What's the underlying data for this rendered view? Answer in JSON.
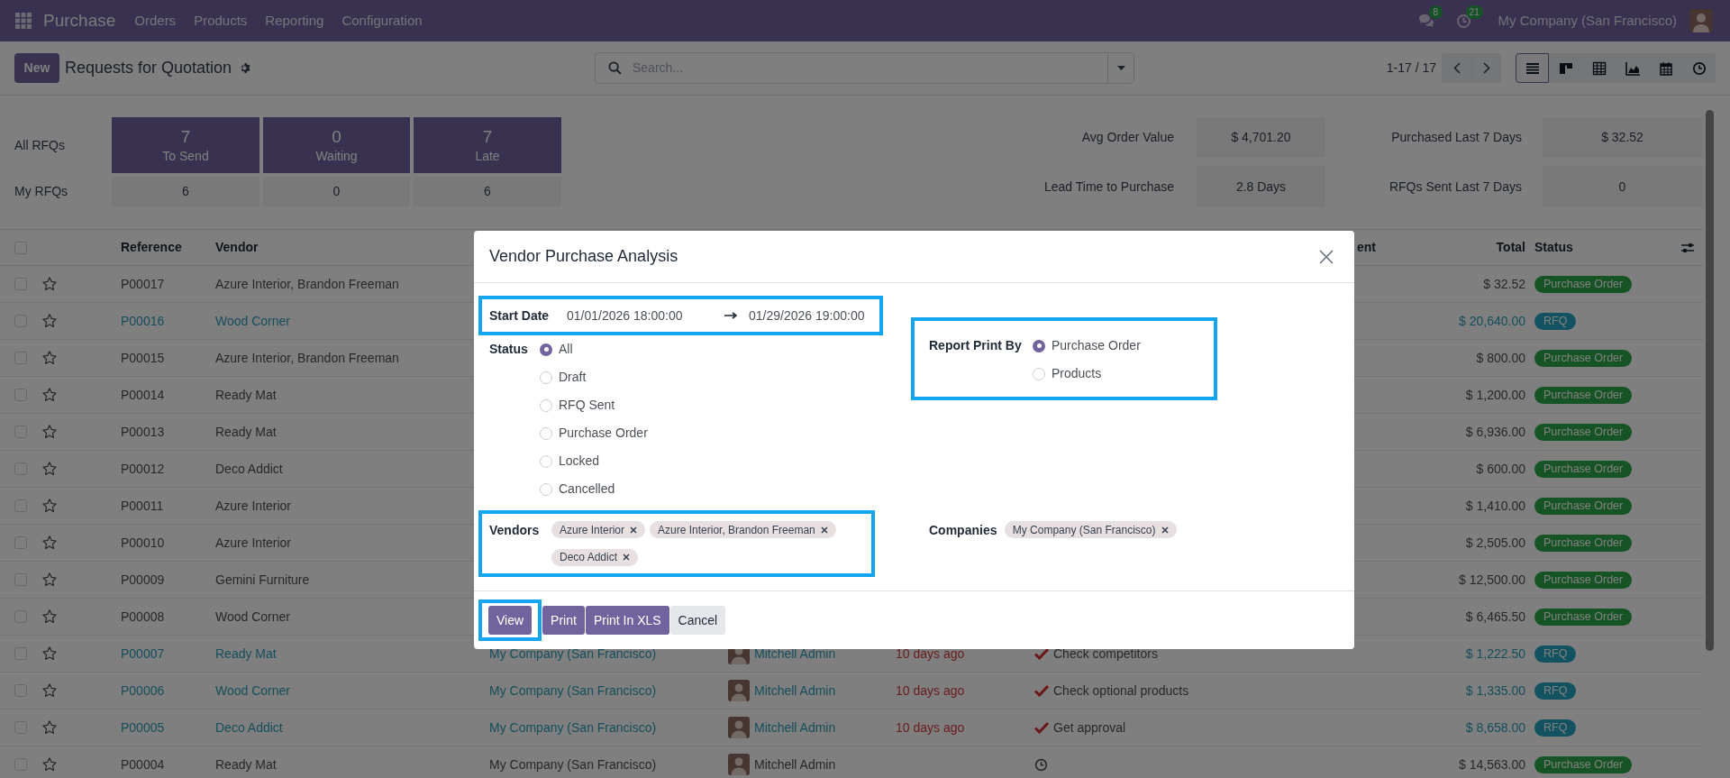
{
  "navbar": {
    "app": "Purchase",
    "menu": [
      "Orders",
      "Products",
      "Reporting",
      "Configuration"
    ],
    "messages_count": "8",
    "activities_count": "21",
    "company": "My Company (San Francisco)"
  },
  "control_panel": {
    "new_button": "New",
    "title": "Requests for Quotation",
    "search": {
      "placeholder": "Search..."
    },
    "pager": "1-17 / 17",
    "views": [
      {
        "kind": "list",
        "selected": true
      },
      {
        "kind": "kanban",
        "selected": false
      },
      {
        "kind": "pivot",
        "selected": false
      },
      {
        "kind": "graph",
        "selected": false
      },
      {
        "kind": "calendar",
        "selected": false
      },
      {
        "kind": "activity",
        "selected": false
      }
    ]
  },
  "dashboard": {
    "row_labels": [
      "All RFQs",
      "My RFQs"
    ],
    "tiles": [
      {
        "count": "7",
        "label": "To Send",
        "mine": "6"
      },
      {
        "count": "0",
        "label": "Waiting",
        "mine": "0"
      },
      {
        "count": "7",
        "label": "Late",
        "mine": "6"
      }
    ],
    "stats": [
      {
        "label": "Avg Order Value",
        "value": "$ 4,701.20"
      },
      {
        "label": "Purchased Last 7 Days",
        "value": "$ 32.52"
      },
      {
        "label": "Lead Time to Purchase",
        "value": "2.8 Days"
      },
      {
        "label": "RFQs Sent Last 7 Days",
        "value": "0"
      }
    ]
  },
  "table": {
    "all_checked": false,
    "columns": [
      {
        "label": "Reference",
        "kind": "reference"
      },
      {
        "label": "Vendor",
        "kind": "vendor"
      },
      {
        "label": "ent",
        "kind": "cut"
      },
      {
        "label": "Total",
        "kind": "total"
      },
      {
        "label": "Status",
        "kind": "status"
      }
    ],
    "rows": [
      {
        "checked": false,
        "starred": false,
        "reference": "P00017",
        "vendor": "Azure Interior, Brandon Freeman",
        "total": "$ 32.52",
        "status": {
          "label": "Purchase Order",
          "kind": "po"
        }
      },
      {
        "checked": false,
        "starred": false,
        "reference": "P00016",
        "vendor": "Wood Corner",
        "total": "$ 20,640.00",
        "status": {
          "label": "RFQ",
          "kind": "rfq"
        }
      },
      {
        "checked": false,
        "starred": false,
        "reference": "P00015",
        "vendor": "Azure Interior, Brandon Freeman",
        "total": "$ 800.00",
        "status": {
          "label": "Purchase Order",
          "kind": "po"
        }
      },
      {
        "checked": false,
        "starred": false,
        "reference": "P00014",
        "vendor": "Ready Mat",
        "total": "$ 1,200.00",
        "status": {
          "label": "Purchase Order",
          "kind": "po"
        }
      },
      {
        "checked": false,
        "starred": false,
        "reference": "P00013",
        "vendor": "Ready Mat",
        "total": "$ 6,936.00",
        "status": {
          "label": "Purchase Order",
          "kind": "po"
        }
      },
      {
        "checked": false,
        "starred": false,
        "reference": "P00012",
        "vendor": "Deco Addict",
        "total": "$ 600.00",
        "status": {
          "label": "Purchase Order",
          "kind": "po"
        }
      },
      {
        "checked": false,
        "starred": false,
        "reference": "P00011",
        "vendor": "Azure Interior",
        "total": "$ 1,410.00",
        "status": {
          "label": "Purchase Order",
          "kind": "po"
        }
      },
      {
        "checked": false,
        "starred": false,
        "reference": "P00010",
        "vendor": "Azure Interior",
        "total": "$ 2,505.00",
        "status": {
          "label": "Purchase Order",
          "kind": "po"
        }
      },
      {
        "checked": false,
        "starred": false,
        "reference": "P00009",
        "vendor": "Gemini Furniture",
        "total": "$ 12,500.00",
        "status": {
          "label": "Purchase Order",
          "kind": "po"
        }
      },
      {
        "checked": false,
        "starred": false,
        "reference": "P00008",
        "vendor": "Wood Corner",
        "total": "$ 6,465.50",
        "status": {
          "label": "Purchase Order",
          "kind": "po"
        }
      },
      {
        "checked": false,
        "starred": false,
        "reference": "P00007",
        "vendor": "Ready Mat",
        "company": "My Company (San Francisco)",
        "buyer": "Mitchell Admin",
        "deadline": "10 days ago",
        "activity": {
          "kind": "check",
          "text": "Check competitors"
        },
        "total": "$ 1,222.50",
        "status": {
          "label": "RFQ",
          "kind": "rfq"
        }
      },
      {
        "checked": false,
        "starred": false,
        "reference": "P00006",
        "vendor": "Wood Corner",
        "company": "My Company (San Francisco)",
        "buyer": "Mitchell Admin",
        "deadline": "10 days ago",
        "activity": {
          "kind": "check",
          "text": "Check optional products"
        },
        "total": "$ 1,335.00",
        "status": {
          "label": "RFQ",
          "kind": "rfq"
        }
      },
      {
        "checked": false,
        "starred": false,
        "reference": "P00005",
        "vendor": "Deco Addict",
        "company": "My Company (San Francisco)",
        "buyer": "Mitchell Admin",
        "deadline": "10 days ago",
        "activity": {
          "kind": "check",
          "text": "Get approval"
        },
        "total": "$ 8,658.00",
        "status": {
          "label": "RFQ",
          "kind": "rfq"
        }
      },
      {
        "checked": false,
        "starred": false,
        "reference": "P00004",
        "vendor": "Ready Mat",
        "company": "My Company (San Francisco)",
        "buyer": "Mitchell Admin",
        "activity": {
          "kind": "clock"
        },
        "total": "$ 14,563.00",
        "status": {
          "label": "Purchase Order",
          "kind": "po"
        }
      }
    ]
  },
  "dialog": {
    "title": "Vendor Purchase Analysis",
    "start_date": {
      "label": "Start Date",
      "from": "01/01/2026 18:00:00",
      "to": "01/29/2026 19:00:00",
      "highlighted": true
    },
    "status": {
      "label": "Status",
      "options": [
        {
          "label": "All",
          "selected": true
        },
        {
          "label": "Draft",
          "selected": false
        },
        {
          "label": "RFQ Sent",
          "selected": false
        },
        {
          "label": "Purchase Order",
          "selected": false
        },
        {
          "label": "Locked",
          "selected": false
        },
        {
          "label": "Cancelled",
          "selected": false
        }
      ]
    },
    "report_print_by": {
      "label": "Report Print By",
      "highlighted": true,
      "options": [
        {
          "label": "Purchase Order",
          "selected": true
        },
        {
          "label": "Products",
          "selected": false
        }
      ]
    },
    "vendors": {
      "label": "Vendors",
      "highlighted": true,
      "tags": [
        "Azure Interior",
        "Azure Interior, Brandon Freeman",
        "Deco Addict"
      ]
    },
    "companies": {
      "label": "Companies",
      "highlighted": false,
      "tags": [
        "My Company (San Francisco)"
      ]
    },
    "buttons": [
      {
        "label": "View",
        "kind": "primary",
        "highlighted": true
      },
      {
        "label": "Print",
        "kind": "primary",
        "highlighted": false
      },
      {
        "label": "Print In XLS",
        "kind": "primary",
        "highlighted": false
      },
      {
        "label": "Cancel",
        "kind": "secondary",
        "highlighted": false
      }
    ]
  }
}
